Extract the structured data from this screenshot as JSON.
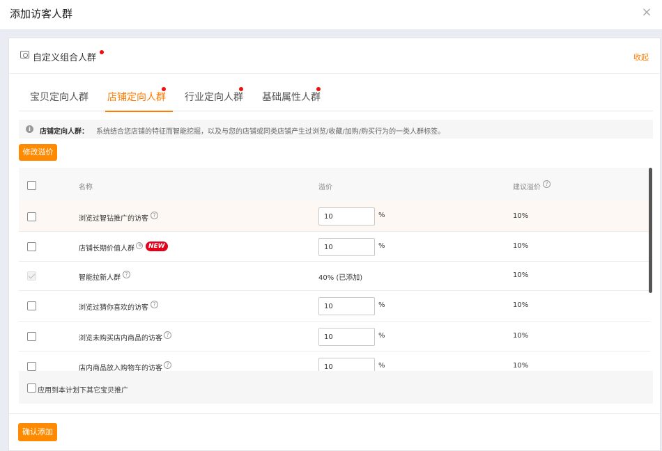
{
  "dialog": {
    "title": "添加访客人群",
    "close_glyph": "×"
  },
  "panel": {
    "title": "自定义组合人群",
    "collapse_label": "收起",
    "tabs": [
      {
        "label": "宝贝定向人群",
        "active": false,
        "dot": false
      },
      {
        "label": "店铺定向人群",
        "active": true,
        "dot": true
      },
      {
        "label": "行业定向人群",
        "active": false,
        "dot": true
      },
      {
        "label": "基础属性人群",
        "active": false,
        "dot": true
      }
    ]
  },
  "tip": {
    "strong": "店铺定向人群：",
    "text": "系统结合您店铺的特征而智能挖掘，以及与您的店铺或同类店铺产生过浏览/收藏/加购/购买行为的一类人群标签。"
  },
  "toolbar": {
    "modify_premium_label": "修改溢价"
  },
  "table": {
    "headers": {
      "name": "名称",
      "premium": "溢价",
      "suggested": "建议溢价"
    },
    "rows": [
      {
        "name": "浏览过智钻推广的访客",
        "premium": "10",
        "unit": "%",
        "suggested": "10%",
        "icon": "question"
      },
      {
        "name": "店铺长期价值人群",
        "premium": "10",
        "unit": "%",
        "suggested": "10%",
        "icon": "user",
        "badge": "NEW"
      },
      {
        "name": "智能拉新人群",
        "status": "40% (已添加)",
        "suggested": "10%",
        "icon": "question",
        "disabled": true
      },
      {
        "name": "浏览过猜你喜欢的访客",
        "premium": "10",
        "unit": "%",
        "suggested": "10%",
        "icon": "question"
      },
      {
        "name": "浏览未购买店内商品的访客",
        "premium": "10",
        "unit": "%",
        "suggested": "10%",
        "icon": "question"
      },
      {
        "name": "店内商品放入购物车的访客",
        "premium": "10",
        "unit": "%",
        "suggested": "10%",
        "icon": "question"
      }
    ]
  },
  "apply_label": "应用到本计划下其它宝贝推广",
  "confirm_label": "确认添加",
  "colors": {
    "accent": "#ff8a00",
    "dot": "#f40d0d",
    "badge": "#e3001b"
  }
}
